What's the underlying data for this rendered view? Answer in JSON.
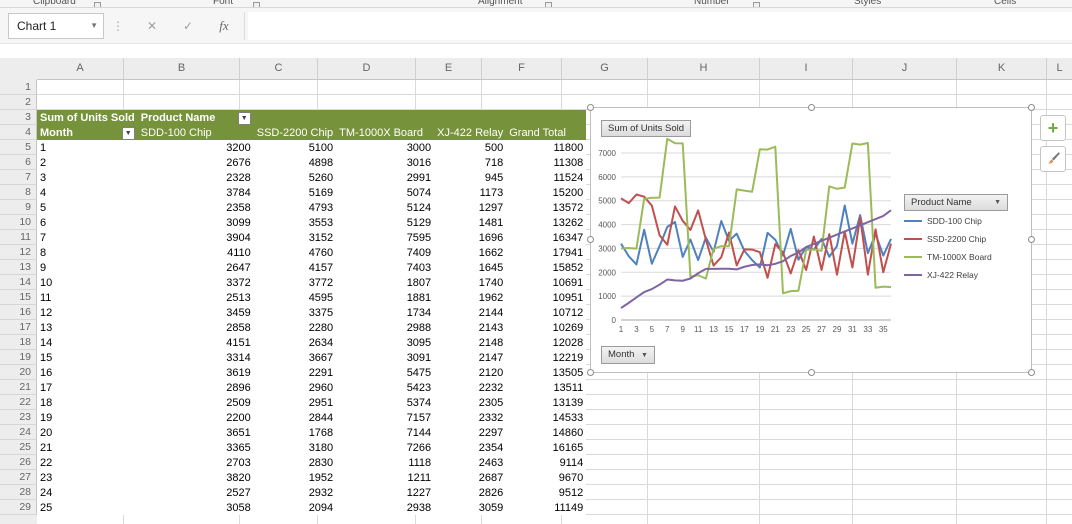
{
  "ribbon": {
    "groups": [
      "Clipboard",
      "Font",
      "Alignment",
      "Number",
      "Styles",
      "Cells"
    ]
  },
  "formula_bar": {
    "name_box": "Chart 1",
    "cancel": "✕",
    "enter": "✓",
    "fx": "fx",
    "formula": ""
  },
  "icons": {
    "dropdown": "▼",
    "plus": "+"
  },
  "sheet": {
    "columns": [
      "A",
      "B",
      "C",
      "D",
      "E",
      "F",
      "G",
      "H",
      "I",
      "J",
      "K",
      "L"
    ],
    "rows": [
      "1",
      "2",
      "3",
      "4",
      "5",
      "6",
      "7",
      "8",
      "9",
      "10",
      "11",
      "12",
      "13",
      "14",
      "15",
      "16",
      "17",
      "18",
      "19",
      "20",
      "21",
      "22",
      "23",
      "24",
      "25",
      "26",
      "27",
      "28",
      "29"
    ]
  },
  "pivot": {
    "title": "Sum of Units Sold",
    "col_field": "Product Name",
    "row_field": "Month",
    "columns": [
      "SDD-100 Chip",
      "SSD-2200 Chip",
      "TM-1000X Board",
      "XJ-422 Relay",
      "Grand Total"
    ],
    "rows": [
      [
        1,
        3200,
        5100,
        3000,
        500,
        11800
      ],
      [
        2,
        2676,
        4898,
        3016,
        718,
        11308
      ],
      [
        3,
        2328,
        5260,
        2991,
        945,
        11524
      ],
      [
        4,
        3784,
        5169,
        5074,
        1173,
        15200
      ],
      [
        5,
        2358,
        4793,
        5124,
        1297,
        13572
      ],
      [
        6,
        3099,
        3553,
        5129,
        1481,
        13262
      ],
      [
        7,
        3904,
        3152,
        7595,
        1696,
        16347
      ],
      [
        8,
        4110,
        4760,
        7409,
        1662,
        17941
      ],
      [
        9,
        2647,
        4157,
        7403,
        1645,
        15852
      ],
      [
        10,
        3372,
        3772,
        1807,
        1740,
        10691
      ],
      [
        11,
        2513,
        4595,
        1881,
        1962,
        10951
      ],
      [
        12,
        3459,
        3375,
        1734,
        2144,
        10712
      ],
      [
        13,
        2858,
        2280,
        2988,
        2143,
        10269
      ],
      [
        14,
        4151,
        2634,
        3095,
        2148,
        12028
      ],
      [
        15,
        3314,
        3667,
        3091,
        2147,
        12219
      ],
      [
        16,
        3619,
        2291,
        5475,
        2120,
        13505
      ],
      [
        17,
        2896,
        2960,
        5423,
        2232,
        13511
      ],
      [
        18,
        2509,
        2951,
        5374,
        2305,
        13139
      ],
      [
        19,
        2200,
        2844,
        7157,
        2332,
        14533
      ],
      [
        20,
        3651,
        1768,
        7144,
        2297,
        14860
      ],
      [
        21,
        3365,
        3180,
        7266,
        2354,
        16165
      ],
      [
        22,
        2703,
        2830,
        1118,
        2463,
        9114
      ],
      [
        23,
        3820,
        1952,
        1211,
        2687,
        9670
      ],
      [
        24,
        2527,
        2932,
        1227,
        2826,
        9512
      ],
      [
        25,
        3058,
        2094,
        2938,
        3059,
        11149
      ]
    ]
  },
  "chart": {
    "value_button": "Sum of Units Sold",
    "legend_button": "Product Name",
    "axis_button": "Month"
  },
  "chart_data": {
    "type": "line",
    "title": "Sum of Units Sold",
    "xlabel": "Month",
    "ylabel": "",
    "legend_title": "Product Name",
    "legend_position": "right",
    "grid": true,
    "ylim": [
      0,
      7000
    ],
    "yticks": [
      0,
      1000,
      2000,
      3000,
      4000,
      5000,
      6000,
      7000
    ],
    "x_tick_labels": [
      "1",
      "3",
      "5",
      "7",
      "9",
      "11",
      "13",
      "15",
      "17",
      "19",
      "21",
      "23",
      "25",
      "27",
      "29",
      "31",
      "33",
      "35"
    ],
    "series": [
      {
        "name": "SDD-100 Chip",
        "color": "#4F81BD",
        "values": [
          3200,
          2676,
          2328,
          3784,
          2358,
          3099,
          3904,
          4110,
          2647,
          3372,
          2513,
          3459,
          2858,
          4151,
          3314,
          3619,
          2896,
          2509,
          2200,
          3651,
          3365,
          2703,
          3820,
          2527,
          3058,
          2950,
          3400,
          2650,
          3100,
          4800,
          3200,
          4400,
          2800,
          3600,
          2700,
          3400
        ]
      },
      {
        "name": "SSD-2200 Chip",
        "color": "#C0504D",
        "values": [
          5100,
          4898,
          5260,
          5169,
          4793,
          3553,
          3152,
          4760,
          4157,
          3772,
          4595,
          3375,
          2280,
          2634,
          3667,
          2291,
          2960,
          2951,
          2844,
          1768,
          3180,
          2830,
          1952,
          2932,
          2094,
          3500,
          2100,
          3600,
          1900,
          3700,
          2200,
          4300,
          1900,
          3800,
          2000,
          3200
        ]
      },
      {
        "name": "TM-1000X Board",
        "color": "#9BBB59",
        "values": [
          3000,
          3016,
          2991,
          5074,
          5124,
          5129,
          7595,
          7409,
          7403,
          1807,
          1881,
          1734,
          2988,
          3095,
          3091,
          5475,
          5423,
          5374,
          7157,
          7144,
          7266,
          1118,
          1211,
          1227,
          2938,
          2960,
          2900,
          5600,
          5500,
          5550,
          7400,
          7350,
          7420,
          1350,
          1400,
          1380
        ]
      },
      {
        "name": "XJ-422 Relay",
        "color": "#8064A2",
        "values": [
          500,
          718,
          945,
          1173,
          1297,
          1481,
          1696,
          1662,
          1645,
          1740,
          1962,
          2144,
          2143,
          2148,
          2147,
          2120,
          2232,
          2305,
          2332,
          2297,
          2354,
          2463,
          2687,
          2826,
          3059,
          3190,
          3320,
          3450,
          3580,
          3710,
          3840,
          3970,
          4100,
          4230,
          4360,
          4600
        ]
      }
    ]
  }
}
